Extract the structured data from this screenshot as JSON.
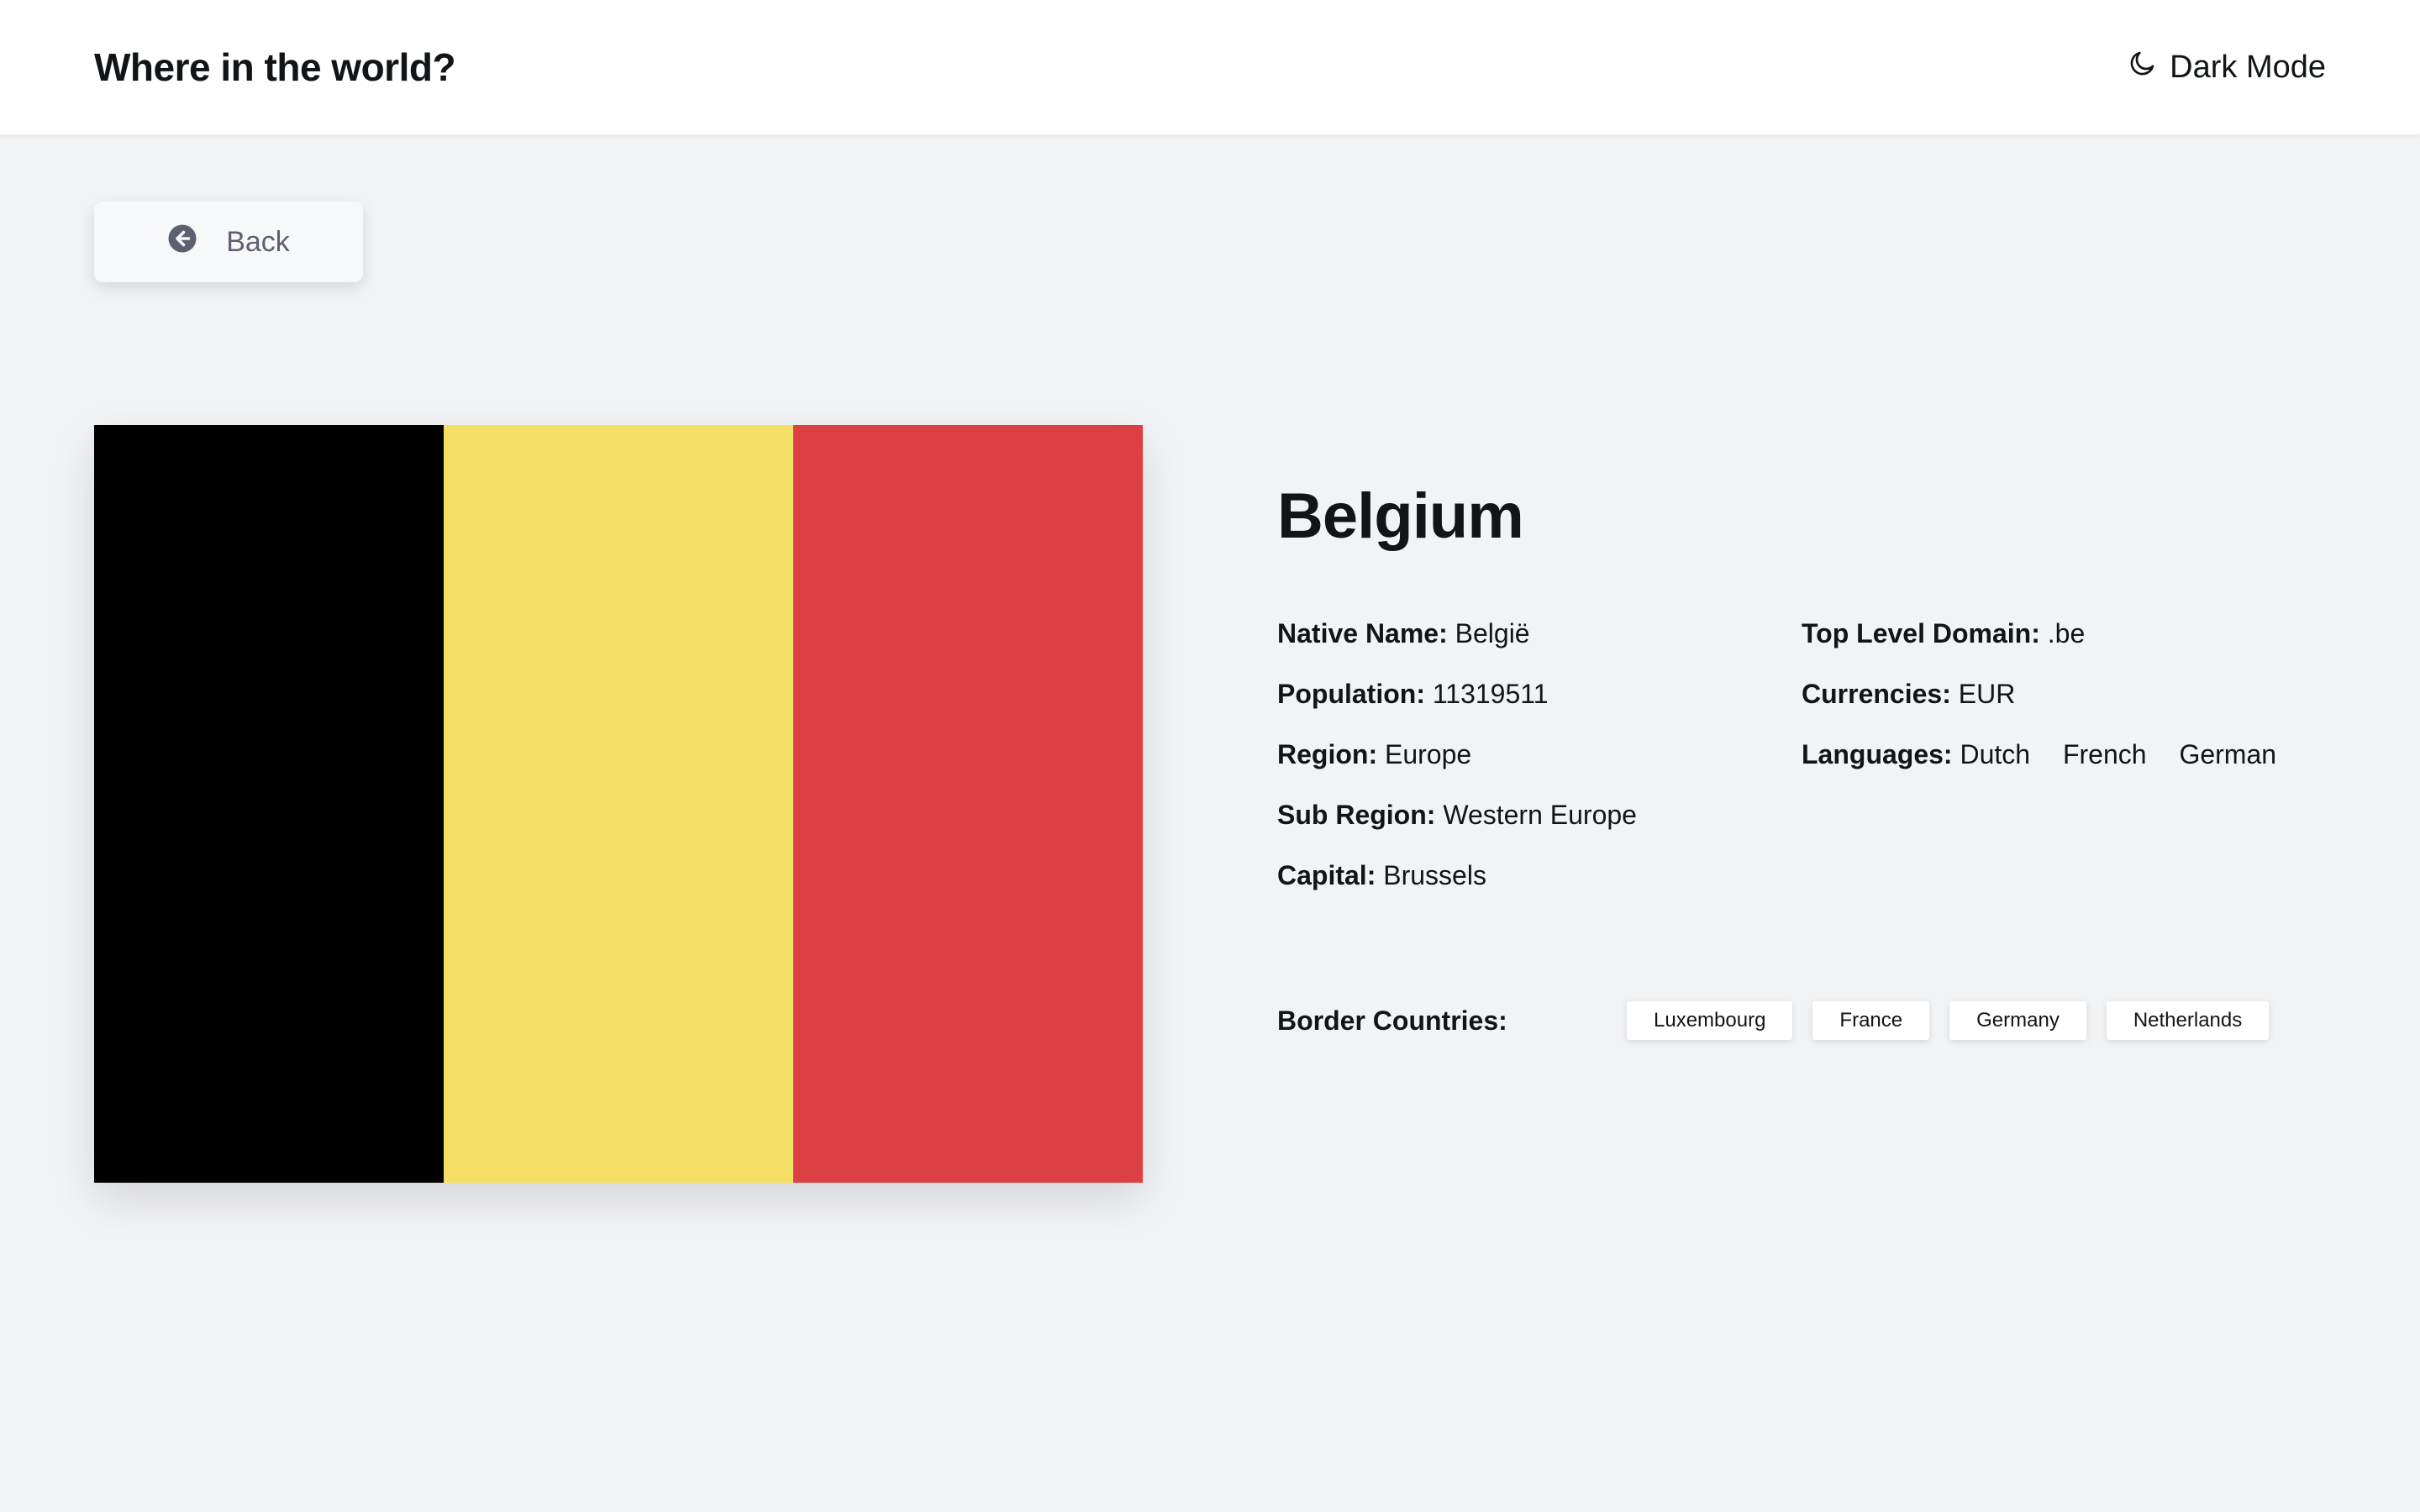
{
  "header": {
    "title": "Where in the world?",
    "dark_mode_label": "Dark Mode",
    "dark_mode_icon": "moon-icon"
  },
  "back": {
    "label": "Back",
    "icon": "arrow-left-circle-icon"
  },
  "country": {
    "name": "Belgium",
    "flag_colors": [
      "#000000",
      "#f6df65",
      "#dc4042"
    ],
    "left_fields": [
      {
        "label": "Native Name:",
        "value": "België"
      },
      {
        "label": "Population:",
        "value": "11319511"
      },
      {
        "label": "Region:",
        "value": "Europe"
      },
      {
        "label": "Sub Region:",
        "value": "Western Europe"
      },
      {
        "label": "Capital:",
        "value": "Brussels"
      }
    ],
    "right_fields": {
      "tld": {
        "label": "Top Level Domain:",
        "value": ".be"
      },
      "currencies": {
        "label": "Currencies:",
        "value": "EUR"
      },
      "languages": {
        "label": "Languages:",
        "values": [
          "Dutch",
          "French",
          "German"
        ]
      }
    },
    "border_label": "Border Countries:",
    "borders": [
      "Luxembourg",
      "France",
      "Germany",
      "Netherlands"
    ]
  }
}
